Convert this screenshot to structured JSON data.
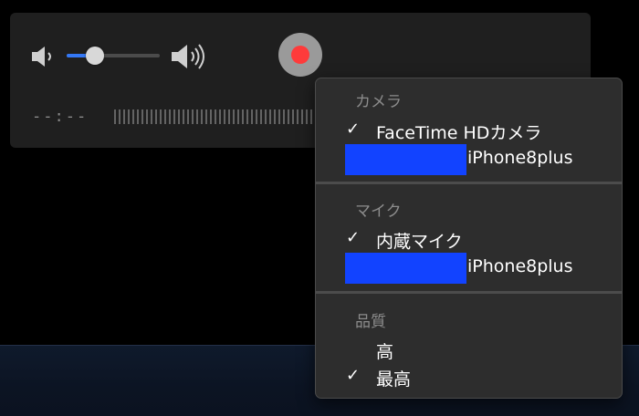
{
  "controls": {
    "volume_level": 0.3,
    "time_display": "--:--",
    "icons": [
      "speaker-low-icon",
      "speaker-high-icon",
      "record-icon"
    ]
  },
  "menu": {
    "camera": {
      "header": "カメラ",
      "items": [
        {
          "label": "FaceTime HDカメラ",
          "checked": true
        },
        {
          "label": "iPhone8plus",
          "checked": false
        }
      ]
    },
    "mic": {
      "header": "マイク",
      "items": [
        {
          "label": "内蔵マイク",
          "checked": true
        },
        {
          "label": "iPhone8plus",
          "checked": false
        }
      ]
    },
    "quality": {
      "header": "品質",
      "items": [
        {
          "label": "高",
          "checked": false
        },
        {
          "label": "最高",
          "checked": true
        }
      ]
    },
    "check_mark": "✓"
  },
  "colors": {
    "record": "#fe3b3b",
    "slider_fill": "#3478f6",
    "redaction": "#1243ff"
  }
}
